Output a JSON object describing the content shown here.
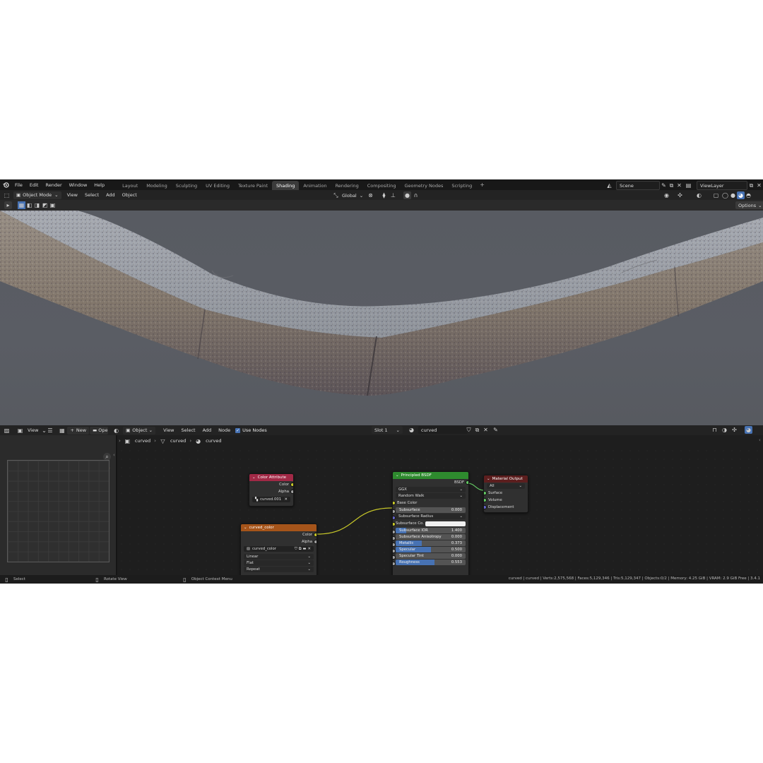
{
  "menu": [
    "File",
    "Edit",
    "Render",
    "Window",
    "Help"
  ],
  "workspaces": [
    "Layout",
    "Modeling",
    "Sculpting",
    "UV Editing",
    "Texture Paint",
    "Shading",
    "Animation",
    "Rendering",
    "Compositing",
    "Geometry Nodes",
    "Scripting"
  ],
  "active_workspace": "Shading",
  "add_workspace": "+",
  "scene": "Scene",
  "view_layer": "ViewLayer",
  "viewport_header": {
    "mode": "Object Mode",
    "menus": [
      "View",
      "Select",
      "Add",
      "Object"
    ],
    "orientation": "Global",
    "options": "Options"
  },
  "image_editor_header": {
    "view": "View",
    "new": "New",
    "open": "Open"
  },
  "node_header": {
    "object": "Object",
    "menus": [
      "View",
      "Select",
      "Add",
      "Node"
    ],
    "use_nodes": "Use Nodes",
    "slot": "Slot 1",
    "material": "curved"
  },
  "breadcrumb": [
    "curved",
    "curved",
    "curved"
  ],
  "nodes": {
    "color_attribute": {
      "title": "Color Attribute",
      "outputs": [
        "Color",
        "Alpha"
      ],
      "attr": "curved.001"
    },
    "image_texture": {
      "title": "curved_color",
      "outputs": [
        "Color",
        "Alpha"
      ],
      "image": "curved_color",
      "interp": "Linear",
      "projection": "Flat",
      "extension": "Repeat"
    },
    "principled": {
      "title": "Principled BSDF",
      "output": "BSDF",
      "distribution": "GGX",
      "sss_method": "Random Walk",
      "base_color": "Base Color",
      "fields": [
        {
          "label": "Subsurface",
          "value": "0.000",
          "fill": 0
        },
        {
          "label": "Subsurface Radius",
          "value": "",
          "dropdown": true
        },
        {
          "label": "Subsurface Co...",
          "value": "",
          "color": "#f0f0f0"
        },
        {
          "label": "Subsurface IOR",
          "value": "1.400",
          "fill": 0.15
        },
        {
          "label": "Subsurface Anisotropy",
          "value": "0.000",
          "fill": 0
        },
        {
          "label": "Metallic",
          "value": "0.373",
          "fill": 0.373
        },
        {
          "label": "Specular",
          "value": "0.500",
          "fill": 0.5
        },
        {
          "label": "Specular Tint",
          "value": "0.000",
          "fill": 0
        },
        {
          "label": "Roughness",
          "value": "0.553",
          "fill": 0.553
        }
      ]
    },
    "material_output": {
      "title": "Material Output",
      "target": "All",
      "inputs": [
        "Surface",
        "Volume",
        "Displacement"
      ]
    }
  },
  "status": {
    "select": "Select",
    "rotate": "Rotate View",
    "context": "Object Context Menu",
    "stats": "curved | curved | Verts:2,575,568 | Faces:5,129,346 | Tris:5,129,347 | Objects:0/2 | Memory: 4.25 GiB | VRAM: 2.9 GiB Free | 3.4.1"
  },
  "colors": {
    "accent": "#4772b3",
    "color_attr_header": "#a12946",
    "image_tex_header": "#a5541a",
    "bsdf_header": "#2e8a2e",
    "output_header": "#5c1e1e",
    "socket_color": "#c7c729",
    "socket_shader": "#63c763",
    "socket_vector": "#6363c7",
    "socket_float": "#a1a1a1"
  }
}
